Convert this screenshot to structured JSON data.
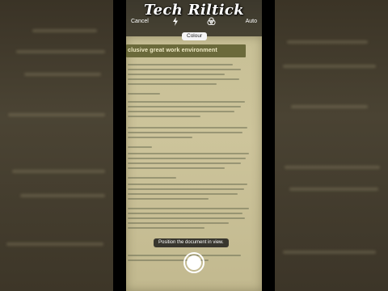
{
  "watermark": {
    "text": "Tech Riltick"
  },
  "scanner": {
    "cancel_label": "Cancel",
    "auto_label": "Auto",
    "flash_icon": "flash-icon",
    "filter_icon": "filter-icon",
    "mode_label": "Colour",
    "hint_text": "Position the document in view.",
    "shutter_icon": "shutter-icon"
  },
  "document": {
    "heading": "clusive great work environment"
  },
  "colors": {
    "overlay_text": "#ffffff",
    "heading_bar": "#6b6a3b",
    "paper": "#cdc49b"
  }
}
